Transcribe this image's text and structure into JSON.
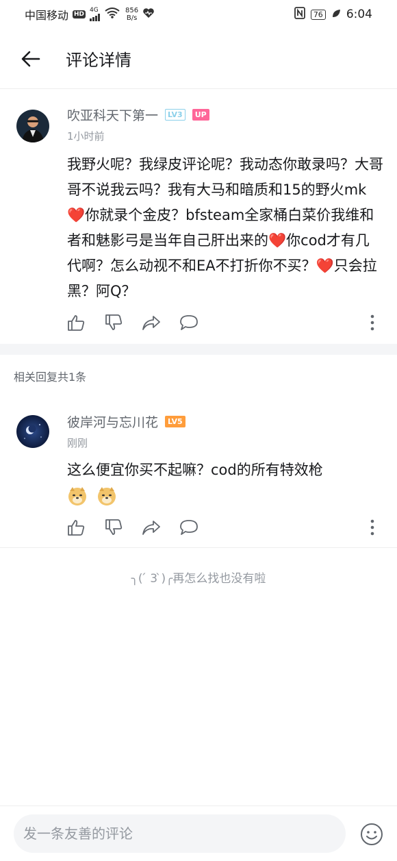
{
  "status_bar": {
    "carrier": "中国移动",
    "hd": "HD",
    "network": "4G",
    "speed_value": "856",
    "speed_unit": "B/s",
    "battery": "76",
    "time": "6:04"
  },
  "header": {
    "title": "评论详情"
  },
  "main_comment": {
    "username": "吹亚科天下第一",
    "level": "LV3",
    "up_badge": "UP",
    "timestamp": "1小时前",
    "text_1": "我野火呢？我绿皮评论呢？我动态你敢录吗？大哥哥不说我云吗？我有大马和暗质和15的野火mk",
    "text_2": "你就录个金皮？bfsteam全家桶白菜价我维和者和魅影弓是当年自己肝出来的",
    "text_3": "你cod才有几代啊？怎么动视不和EA不打折你不买？",
    "text_4": "只会拉黑？阿Q？",
    "heart": "❤️"
  },
  "reply_summary": {
    "label": "相关回复共1条"
  },
  "reply": {
    "username": "彼岸河与忘川花",
    "level": "LV5",
    "timestamp": "刚刚",
    "text": "这么便宜你买不起嘛？cod的所有特效枪"
  },
  "end_message": {
    "face": "╮( ́ 3 ̀)╭",
    "text": "再怎么找也没有啦"
  },
  "bottom_bar": {
    "placeholder": "发一条友善的评论"
  },
  "colors": {
    "text_primary": "#18191c",
    "text_secondary": "#61666d",
    "text_muted": "#9499a0",
    "up_pink": "#ff6699",
    "lv3_blue": "#8bd0ea",
    "lv5_orange": "#ff9d3b",
    "heart_red": "#e8202f"
  },
  "icons": [
    "back-arrow-icon",
    "like-icon",
    "dislike-icon",
    "share-icon",
    "reply-icon",
    "more-icon",
    "emoji-icon",
    "doge-emoji-icon",
    "wifi-icon",
    "signal-icon",
    "nfc-icon",
    "heart-health-icon",
    "leaf-icon"
  ]
}
